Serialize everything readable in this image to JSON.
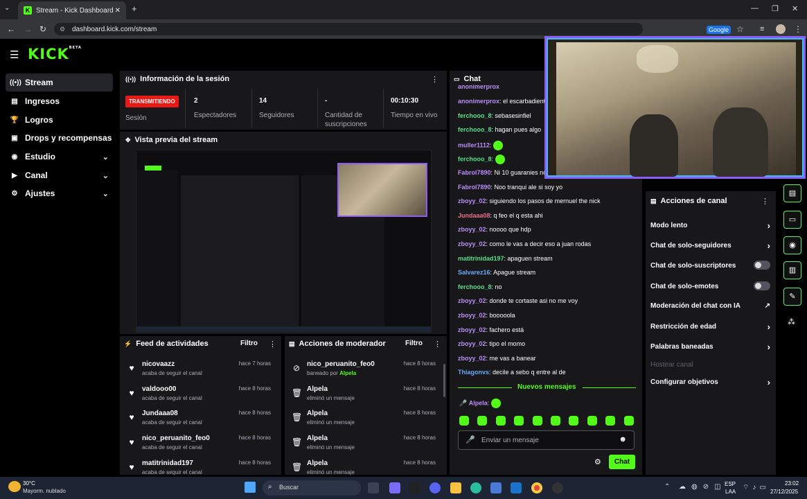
{
  "browser": {
    "tab_title": "Stream - Kick Dashboard",
    "url": "dashboard.kick.com/stream",
    "google_label": "Google"
  },
  "brand": {
    "logo": "KICK",
    "beta": "BETA",
    "accent": "#53fc18"
  },
  "sidebar": {
    "items": [
      {
        "label": "Stream",
        "icon": "stream-icon"
      },
      {
        "label": "Ingresos",
        "icon": "revenue-icon"
      },
      {
        "label": "Logros",
        "icon": "trophy-icon"
      },
      {
        "label": "Drops y recompensas",
        "icon": "gift-icon"
      },
      {
        "label": "Estudio",
        "icon": "studio-icon"
      },
      {
        "label": "Canal",
        "icon": "channel-icon"
      },
      {
        "label": "Ajustes",
        "icon": "gear-icon"
      }
    ]
  },
  "session": {
    "title": "Información de la sesión",
    "status_badge": "TRANSMITIENDO",
    "status_label": "Sesión",
    "viewers": "2",
    "viewers_label": "Espectadores",
    "followers": "14",
    "followers_label": "Seguidores",
    "subs": "-",
    "subs_label_1": "Cantidad de",
    "subs_label_2": "suscripciones",
    "live_time": "00:10:30",
    "live_time_label": "Tiempo en vivo"
  },
  "preview": {
    "title": "Vista previa del stream"
  },
  "activity": {
    "title": "Feed de actividades",
    "filter": "Filtro",
    "items": [
      {
        "name": "nicovaazz",
        "sub": "acaba de seguir el canal",
        "time": "hace 7 horas"
      },
      {
        "name": "valdooo00",
        "sub": "acaba de seguir el canal",
        "time": "hace 8 horas"
      },
      {
        "name": "Jundaaa08",
        "sub": "acaba de seguir el canal",
        "time": "hace 8 horas"
      },
      {
        "name": "nico_peruanito_feo0",
        "sub": "acaba de seguir el canal",
        "time": "hace 8 horas"
      },
      {
        "name": "matitrinidad197",
        "sub": "acaba de seguir el canal",
        "time": "hace 8 horas"
      }
    ]
  },
  "moderator": {
    "title": "Acciones de moderador",
    "filter": "Filtro",
    "items": [
      {
        "name": "nico_peruanito_feo0",
        "sub_prefix": "baneado por ",
        "sub_user": "Alpela",
        "time": "hace 8 horas"
      },
      {
        "name": "Alpela",
        "sub": "eliminó un mensaje",
        "time": "hace 8 horas"
      },
      {
        "name": "Alpela",
        "sub": "eliminó un mensaje",
        "time": "hace 8 horas"
      },
      {
        "name": "Alpela",
        "sub": "eliminó un mensaje",
        "time": "hace 8 horas"
      },
      {
        "name": "Alpela",
        "sub": "eliminó un mensaje",
        "time": "hace 8 horas"
      }
    ]
  },
  "chat": {
    "title": "Chat",
    "messages": [
      {
        "user": "anonimerprox",
        "text": "el escarbadiente",
        "color": "#b98cf7"
      },
      {
        "user": "ferchooo_8",
        "text": "sebasesinfiel",
        "color": "#5bdc8a"
      },
      {
        "user": "ferchooo_8",
        "text": "hagan pues algo",
        "color": "#5bdc8a"
      },
      {
        "user": "muller1112",
        "text": "",
        "color": "#b98cf7",
        "emote": true
      },
      {
        "user": "ferchooo_8",
        "text": "",
        "color": "#5bdc8a",
        "emote": true
      },
      {
        "user": "Fabrol7890",
        "text": "Ni 10 guaranies nos",
        "color": "#b98cf7"
      },
      {
        "user": "Fabrol7890",
        "text": "Noo tranqui ale si soy yo",
        "color": "#b98cf7"
      },
      {
        "user": "zboyy_02",
        "text": "siguiendo los pasos de mernuel the nick",
        "color": "#b98cf7"
      },
      {
        "user": "Jundaaa08",
        "text": "q feo el q esta ahi",
        "color": "#e96f8c"
      },
      {
        "user": "zboyy_02",
        "text": "noooo que hdp",
        "color": "#b98cf7"
      },
      {
        "user": "zboyy_02",
        "text": "como le vas a decir eso a juan rodas",
        "color": "#b98cf7"
      },
      {
        "user": "matitrinidad197",
        "text": "apaguen stream",
        "color": "#5bdc8a"
      },
      {
        "user": "Salvarez16",
        "text": "Apague stream",
        "color": "#6aa8f7"
      },
      {
        "user": "ferchooo_8",
        "text": "no",
        "color": "#5bdc8a"
      },
      {
        "user": "zboyy_02",
        "text": "donde te cortaste asi no me voy",
        "color": "#b98cf7"
      },
      {
        "user": "zboyy_02",
        "text": "booooola",
        "color": "#b98cf7"
      },
      {
        "user": "zboyy_02",
        "text": "fachero está",
        "color": "#b98cf7"
      },
      {
        "user": "zboyy_02",
        "text": "tipo el momo",
        "color": "#b98cf7"
      },
      {
        "user": "zboyy_02",
        "text": "me vas a banear",
        "color": "#b98cf7"
      },
      {
        "user": "Thiagonvs",
        "text": "decile a sebo q entre al de",
        "color": "#6aa8f7"
      }
    ],
    "new_messages": "Nuevos mensajes",
    "last_user": "Alpela",
    "placeholder": "Enviar un mensaje",
    "send": "Chat"
  },
  "channel_actions": {
    "title": "Acciones de canal",
    "items": [
      {
        "label": "Modo lento",
        "kind": "arrow"
      },
      {
        "label": "Chat de solo-seguidores",
        "kind": "arrow"
      },
      {
        "label": "Chat de solo-suscriptores",
        "kind": "toggle"
      },
      {
        "label": "Chat de solo-emotes",
        "kind": "toggle"
      },
      {
        "label": "Moderación del chat con IA",
        "kind": "external"
      },
      {
        "label": "Restricción de edad",
        "kind": "arrow"
      },
      {
        "label": "Palabras baneadas",
        "kind": "arrow"
      },
      {
        "label": "Hostear canal",
        "kind": "disabled"
      },
      {
        "label": "Configurar objetivos",
        "kind": "arrow"
      }
    ]
  },
  "taskbar": {
    "temp": "30°C",
    "weather": "Mayorm. nublado",
    "search": "Buscar",
    "lang1": "ESP",
    "lang2": "LAA",
    "time": "23:02",
    "date": "27/12/2025"
  }
}
